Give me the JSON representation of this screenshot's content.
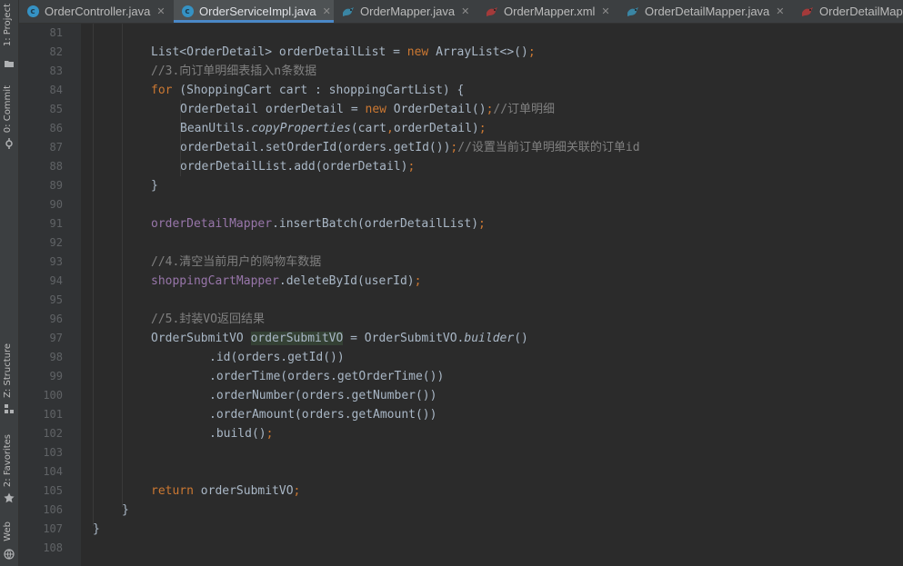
{
  "tabs": [
    {
      "label": "OrderController.java",
      "icon": "class-icon",
      "active": false
    },
    {
      "label": "OrderServiceImpl.java",
      "icon": "class-icon",
      "active": true
    },
    {
      "label": "OrderMapper.java",
      "icon": "mybatis-bird-icon",
      "active": false
    },
    {
      "label": "OrderMapper.xml",
      "icon": "mybatis-bird-icon",
      "active": false
    },
    {
      "label": "OrderDetailMapper.java",
      "icon": "mybatis-bird-icon",
      "active": false
    },
    {
      "label": "OrderDetailMap",
      "icon": "mybatis-bird-icon",
      "active": false
    }
  ],
  "tool_windows": [
    {
      "label": "1: Project",
      "icon": "folder-icon"
    },
    {
      "label": "0: Commit",
      "icon": "commit-icon"
    },
    {
      "label": "Z: Structure",
      "icon": "structure-icon"
    },
    {
      "label": "2: Favorites",
      "icon": "star-icon"
    },
    {
      "label": "Web",
      "icon": "globe-icon"
    }
  ],
  "line_numbers": [
    "81",
    "82",
    "83",
    "84",
    "85",
    "86",
    "87",
    "88",
    "89",
    "90",
    "91",
    "92",
    "93",
    "94",
    "95",
    "96",
    "97",
    "98",
    "99",
    "100",
    "101",
    "102",
    "103",
    "104",
    "105",
    "106",
    "107",
    "108"
  ],
  "code": {
    "l82": {
      "t1": "List<OrderDetail> orderDetailList = ",
      "t2": "new",
      "t3": " ArrayList<>()",
      "t4": ";"
    },
    "l83": {
      "t1": "//3.向订单明细表插入n条数据"
    },
    "l84": {
      "t1": "for",
      "t2": " (ShoppingCart cart : shoppingCartList) {"
    },
    "l85": {
      "t1": "OrderDetail orderDetail = ",
      "t2": "new",
      "t3": " OrderDetail()",
      "t4": ";",
      "t5": "//订单明细"
    },
    "l86": {
      "t1": "BeanUtils.",
      "t2": "copyProperties",
      "t3": "(cart",
      "t4": ",",
      "t5": "orderDetail)",
      "t6": ";"
    },
    "l87": {
      "t1": "orderDetail.setOrderId(orders.getId())",
      "t2": ";",
      "t3": "//设置当前订单明细关联的订单id"
    },
    "l88": {
      "t1": "orderDetailList.add(orderDetail)",
      "t2": ";"
    },
    "l89": {
      "t1": "}"
    },
    "l91": {
      "t1": "orderDetailMapper",
      "t2": ".insertBatch(orderDetailList)",
      "t3": ";"
    },
    "l93": {
      "t1": "//4.清空当前用户的购物车数据"
    },
    "l94": {
      "t1": "shoppingCartMapper",
      "t2": ".deleteById(userId)",
      "t3": ";"
    },
    "l96": {
      "t1": "//5.封装VO返回结果"
    },
    "l97": {
      "t1": "OrderSubmitVO ",
      "t2": "orderSubmitVO",
      "t3": " = OrderSubmitVO.",
      "t4": "builder",
      "t5": "()"
    },
    "l98": {
      "t1": ".id(orders.getId())"
    },
    "l99": {
      "t1": ".orderTime(orders.getOrderTime())"
    },
    "l100": {
      "t1": ".orderNumber(orders.getNumber())"
    },
    "l101": {
      "t1": ".orderAmount(orders.getAmount())"
    },
    "l102": {
      "t1": ".build()",
      "t2": ";"
    },
    "l105": {
      "t1": "return",
      "t2": " orderSubmitVO",
      "t3": ";"
    },
    "l106": {
      "t1": "}"
    },
    "l107": {
      "t1": "}"
    }
  },
  "colors": {
    "background": "#2b2b2b",
    "gutter": "#313335",
    "keyword": "#cc7832",
    "comment": "#808080",
    "field": "#9876aa",
    "default_text": "#a9b7c6",
    "active_tab_underline": "#4a88c7"
  }
}
